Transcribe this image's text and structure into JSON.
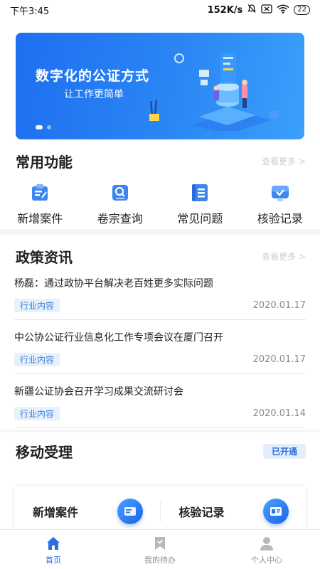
{
  "status_bar": {
    "time": "下午3:45",
    "network_speed": "152K/s",
    "battery": "22"
  },
  "banner": {
    "title": "数字化的公证方式",
    "subtitle": "让工作更简单"
  },
  "quick_functions": {
    "title": "常用功能",
    "more": "查看更多 >",
    "items": [
      {
        "label": "新增案件",
        "icon": "new-case-icon"
      },
      {
        "label": "卷宗查询",
        "icon": "file-search-icon"
      },
      {
        "label": "常见问题",
        "icon": "faq-icon"
      },
      {
        "label": "核验记录",
        "icon": "verify-record-icon"
      }
    ]
  },
  "policy_news": {
    "title": "政策资讯",
    "more": "查看更多 >",
    "items": [
      {
        "title": "杨磊：通过政协平台解决老百姓更多实际问题",
        "tag": "行业内容",
        "date": "2020.01.17"
      },
      {
        "title": "中公协公证行业信息化工作专项会议在厦门召开",
        "tag": "行业内容",
        "date": "2020.01.17"
      },
      {
        "title": "新疆公证协会召开学习成果交流研讨会",
        "tag": "行业内容",
        "date": "2020.01.14"
      }
    ]
  },
  "mobile_accept": {
    "title": "移动受理",
    "status": "已开通",
    "cards": [
      {
        "label": "新增案件",
        "icon": "case-form-icon"
      },
      {
        "label": "核验记录",
        "icon": "id-card-icon"
      }
    ]
  },
  "tabbar": {
    "items": [
      {
        "label": "首页",
        "icon": "home-icon",
        "active": true
      },
      {
        "label": "我的待办",
        "icon": "bookmark-icon",
        "active": false
      },
      {
        "label": "个人中心",
        "icon": "person-icon",
        "active": false
      }
    ]
  },
  "colors": {
    "accent": "#2b6fde",
    "banner_start": "#1f6ff0",
    "banner_end": "#3aa0fb",
    "tag_bg": "#e7f1fc"
  }
}
